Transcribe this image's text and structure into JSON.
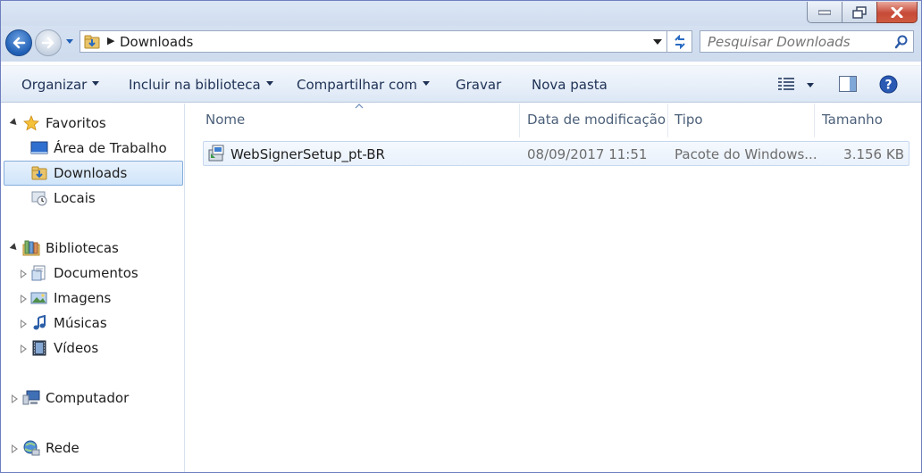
{
  "window": {
    "minimize_icon": "minimize-icon",
    "restore_icon": "restore-icon",
    "close_icon": "close-icon"
  },
  "address": {
    "path": "Downloads",
    "search_placeholder": "Pesquisar Downloads"
  },
  "toolbar": {
    "organizar": "Organizar",
    "incluir": "Incluir na biblioteca",
    "compartilhar": "Compartilhar com",
    "gravar": "Gravar",
    "nova_pasta": "Nova pasta"
  },
  "sidebar": {
    "favoritos": {
      "label": "Favoritos",
      "items": [
        {
          "label": "Área de Trabalho",
          "icon": "desktop-icon"
        },
        {
          "label": "Downloads",
          "icon": "downloads-folder-icon",
          "selected": true
        },
        {
          "label": "Locais",
          "icon": "recent-places-icon"
        }
      ]
    },
    "bibliotecas": {
      "label": "Bibliotecas",
      "items": [
        {
          "label": "Documentos",
          "icon": "documents-icon"
        },
        {
          "label": "Imagens",
          "icon": "pictures-icon"
        },
        {
          "label": "Músicas",
          "icon": "music-icon"
        },
        {
          "label": "Vídeos",
          "icon": "videos-icon"
        }
      ]
    },
    "computador": "Computador",
    "rede": "Rede"
  },
  "columns": {
    "name": "Nome",
    "date": "Data de modificação",
    "type": "Tipo",
    "size": "Tamanho"
  },
  "files": [
    {
      "name": "WebSignerSetup_pt-BR",
      "date": "08/09/2017 11:51",
      "type": "Pacote do Windows...",
      "size": "3.156 KB",
      "icon": "msi-installer-icon"
    }
  ],
  "colors": {
    "accent": "#1f5fb5",
    "selection": "#d0e5fa",
    "close": "#c74a38"
  }
}
